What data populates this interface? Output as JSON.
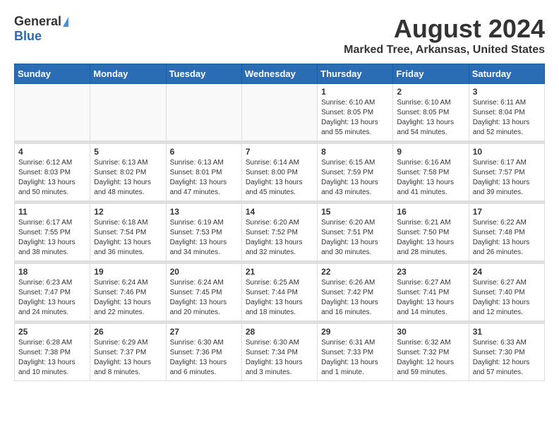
{
  "logo": {
    "general": "General",
    "blue": "Blue"
  },
  "title": "August 2024",
  "subtitle": "Marked Tree, Arkansas, United States",
  "headers": [
    "Sunday",
    "Monday",
    "Tuesday",
    "Wednesday",
    "Thursday",
    "Friday",
    "Saturday"
  ],
  "weeks": [
    [
      {
        "day": "",
        "info": ""
      },
      {
        "day": "",
        "info": ""
      },
      {
        "day": "",
        "info": ""
      },
      {
        "day": "",
        "info": ""
      },
      {
        "day": "1",
        "info": "Sunrise: 6:10 AM\nSunset: 8:05 PM\nDaylight: 13 hours\nand 55 minutes."
      },
      {
        "day": "2",
        "info": "Sunrise: 6:10 AM\nSunset: 8:05 PM\nDaylight: 13 hours\nand 54 minutes."
      },
      {
        "day": "3",
        "info": "Sunrise: 6:11 AM\nSunset: 8:04 PM\nDaylight: 13 hours\nand 52 minutes."
      }
    ],
    [
      {
        "day": "4",
        "info": "Sunrise: 6:12 AM\nSunset: 8:03 PM\nDaylight: 13 hours\nand 50 minutes."
      },
      {
        "day": "5",
        "info": "Sunrise: 6:13 AM\nSunset: 8:02 PM\nDaylight: 13 hours\nand 48 minutes."
      },
      {
        "day": "6",
        "info": "Sunrise: 6:13 AM\nSunset: 8:01 PM\nDaylight: 13 hours\nand 47 minutes."
      },
      {
        "day": "7",
        "info": "Sunrise: 6:14 AM\nSunset: 8:00 PM\nDaylight: 13 hours\nand 45 minutes."
      },
      {
        "day": "8",
        "info": "Sunrise: 6:15 AM\nSunset: 7:59 PM\nDaylight: 13 hours\nand 43 minutes."
      },
      {
        "day": "9",
        "info": "Sunrise: 6:16 AM\nSunset: 7:58 PM\nDaylight: 13 hours\nand 41 minutes."
      },
      {
        "day": "10",
        "info": "Sunrise: 6:17 AM\nSunset: 7:57 PM\nDaylight: 13 hours\nand 39 minutes."
      }
    ],
    [
      {
        "day": "11",
        "info": "Sunrise: 6:17 AM\nSunset: 7:55 PM\nDaylight: 13 hours\nand 38 minutes."
      },
      {
        "day": "12",
        "info": "Sunrise: 6:18 AM\nSunset: 7:54 PM\nDaylight: 13 hours\nand 36 minutes."
      },
      {
        "day": "13",
        "info": "Sunrise: 6:19 AM\nSunset: 7:53 PM\nDaylight: 13 hours\nand 34 minutes."
      },
      {
        "day": "14",
        "info": "Sunrise: 6:20 AM\nSunset: 7:52 PM\nDaylight: 13 hours\nand 32 minutes."
      },
      {
        "day": "15",
        "info": "Sunrise: 6:20 AM\nSunset: 7:51 PM\nDaylight: 13 hours\nand 30 minutes."
      },
      {
        "day": "16",
        "info": "Sunrise: 6:21 AM\nSunset: 7:50 PM\nDaylight: 13 hours\nand 28 minutes."
      },
      {
        "day": "17",
        "info": "Sunrise: 6:22 AM\nSunset: 7:48 PM\nDaylight: 13 hours\nand 26 minutes."
      }
    ],
    [
      {
        "day": "18",
        "info": "Sunrise: 6:23 AM\nSunset: 7:47 PM\nDaylight: 13 hours\nand 24 minutes."
      },
      {
        "day": "19",
        "info": "Sunrise: 6:24 AM\nSunset: 7:46 PM\nDaylight: 13 hours\nand 22 minutes."
      },
      {
        "day": "20",
        "info": "Sunrise: 6:24 AM\nSunset: 7:45 PM\nDaylight: 13 hours\nand 20 minutes."
      },
      {
        "day": "21",
        "info": "Sunrise: 6:25 AM\nSunset: 7:44 PM\nDaylight: 13 hours\nand 18 minutes."
      },
      {
        "day": "22",
        "info": "Sunrise: 6:26 AM\nSunset: 7:42 PM\nDaylight: 13 hours\nand 16 minutes."
      },
      {
        "day": "23",
        "info": "Sunrise: 6:27 AM\nSunset: 7:41 PM\nDaylight: 13 hours\nand 14 minutes."
      },
      {
        "day": "24",
        "info": "Sunrise: 6:27 AM\nSunset: 7:40 PM\nDaylight: 13 hours\nand 12 minutes."
      }
    ],
    [
      {
        "day": "25",
        "info": "Sunrise: 6:28 AM\nSunset: 7:38 PM\nDaylight: 13 hours\nand 10 minutes."
      },
      {
        "day": "26",
        "info": "Sunrise: 6:29 AM\nSunset: 7:37 PM\nDaylight: 13 hours\nand 8 minutes."
      },
      {
        "day": "27",
        "info": "Sunrise: 6:30 AM\nSunset: 7:36 PM\nDaylight: 13 hours\nand 6 minutes."
      },
      {
        "day": "28",
        "info": "Sunrise: 6:30 AM\nSunset: 7:34 PM\nDaylight: 13 hours\nand 3 minutes."
      },
      {
        "day": "29",
        "info": "Sunrise: 6:31 AM\nSunset: 7:33 PM\nDaylight: 13 hours\nand 1 minute."
      },
      {
        "day": "30",
        "info": "Sunrise: 6:32 AM\nSunset: 7:32 PM\nDaylight: 12 hours\nand 59 minutes."
      },
      {
        "day": "31",
        "info": "Sunrise: 6:33 AM\nSunset: 7:30 PM\nDaylight: 12 hours\nand 57 minutes."
      }
    ]
  ]
}
